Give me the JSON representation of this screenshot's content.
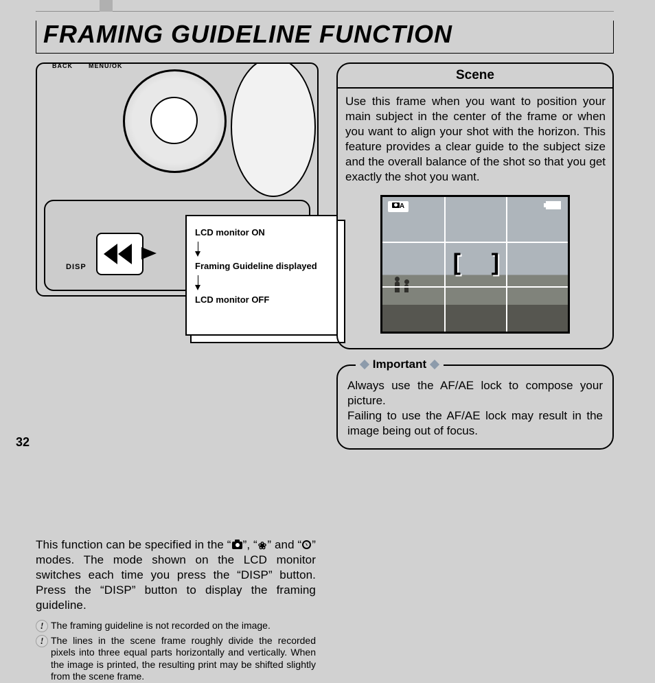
{
  "page": {
    "number": "32",
    "title": "FRAMING GUIDELINE FUNCTION"
  },
  "illustration": {
    "labels": {
      "back": "BACK",
      "menuok": "MENU/OK",
      "disp": "DISP",
      "back2": "BA"
    },
    "callout": {
      "state_on": "LCD monitor ON",
      "state_guideline": "Framing Guideline displayed",
      "state_off": "LCD monitor OFF"
    }
  },
  "intro_text_parts": {
    "a": "This function can be specified in the “",
    "b": "”, “",
    "c": "” and “",
    "d": "” modes. The mode shown on the LCD monitor switches each time you press the “DISP” button. Press the “DISP” button to display the framing guideline."
  },
  "notes": [
    "The framing guideline is not recorded on the image.",
    "The lines in the scene frame roughly divide the recorded pixels into three equal parts horizontally and vertically. When the image is printed, the resulting print may be shifted slightly from the scene frame."
  ],
  "scene": {
    "heading": "Scene",
    "body": "Use this frame when you want to position your main subject in the center of the frame or when you want to align your shot with the horizon. This feature provides a clear guide to the subject size and the overall balance of the shot so that you get exactly the shot you want.",
    "mode_badge_letter": "A"
  },
  "important": {
    "label": "Important",
    "body": "Always use the AF/AE lock to compose your picture.\nFailing to use the AF/AE lock may result in the image being out of focus."
  }
}
